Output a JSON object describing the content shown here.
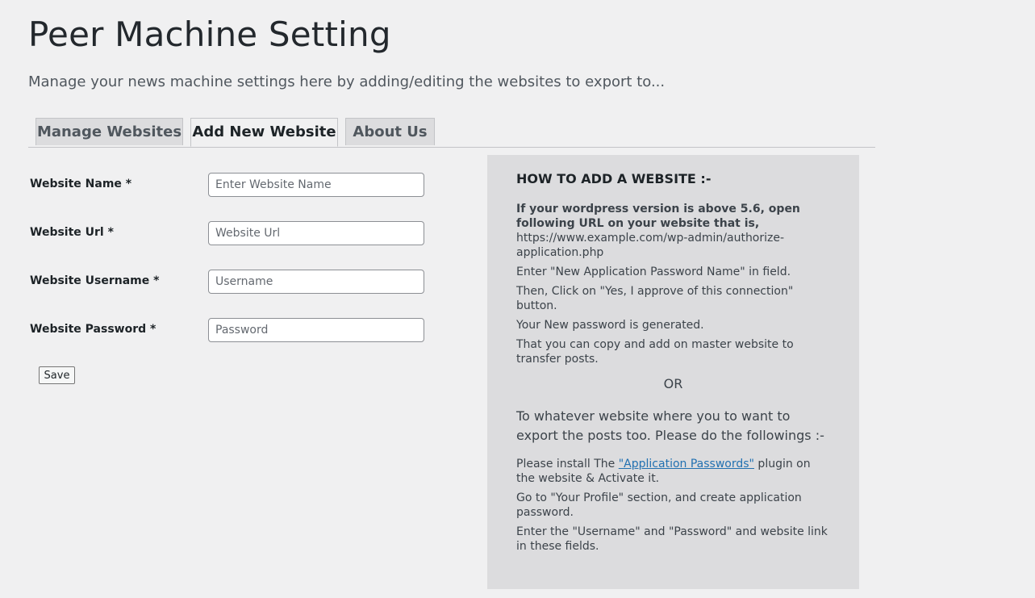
{
  "header": {
    "title": "Peer Machine Setting",
    "subtitle": "Manage your news machine settings here by adding/editing the websites to export to..."
  },
  "tabs": [
    {
      "label": "Manage Websites",
      "active": false
    },
    {
      "label": "Add New Website",
      "active": true
    },
    {
      "label": "About Us",
      "active": false
    }
  ],
  "form": {
    "fields": [
      {
        "label": "Website Name *",
        "placeholder": "Enter Website Name",
        "value": ""
      },
      {
        "label": "Website Url *",
        "placeholder": "Website Url",
        "value": ""
      },
      {
        "label": "Website Username *",
        "placeholder": "Username",
        "value": ""
      },
      {
        "label": "Website Password *",
        "placeholder": "Password",
        "value": ""
      }
    ],
    "save_label": "Save"
  },
  "help": {
    "title": "HOW TO ADD A WEBSITE :-",
    "intro": "If your wordpress version is above 5.6, open following URL on your website that is,",
    "url": "https://www.example.com/wp-admin/authorize-application.php",
    "steps": [
      "Enter \"New Application Password Name\" in field.",
      "Then, Click on \"Yes, I approve of this connection\" button.",
      "Your New password is generated.",
      "That you can copy and add on master website to transfer posts."
    ],
    "or": "OR",
    "lead": "To whatever website where you to want to export the posts too. Please do the followings :-",
    "plugin_prefix": "Please install The ",
    "plugin_link": "\"Application Passwords\"",
    "plugin_suffix": " plugin on the website & Activate it.",
    "steps2": [
      "Go to \"Your Profile\" section, and create application password.",
      "Enter the \"Username\" and \"Password\" and website link in these fields."
    ]
  },
  "colors": {
    "background": "#f0f0f1",
    "panel": "#dcdcde",
    "link": "#2271b1"
  }
}
